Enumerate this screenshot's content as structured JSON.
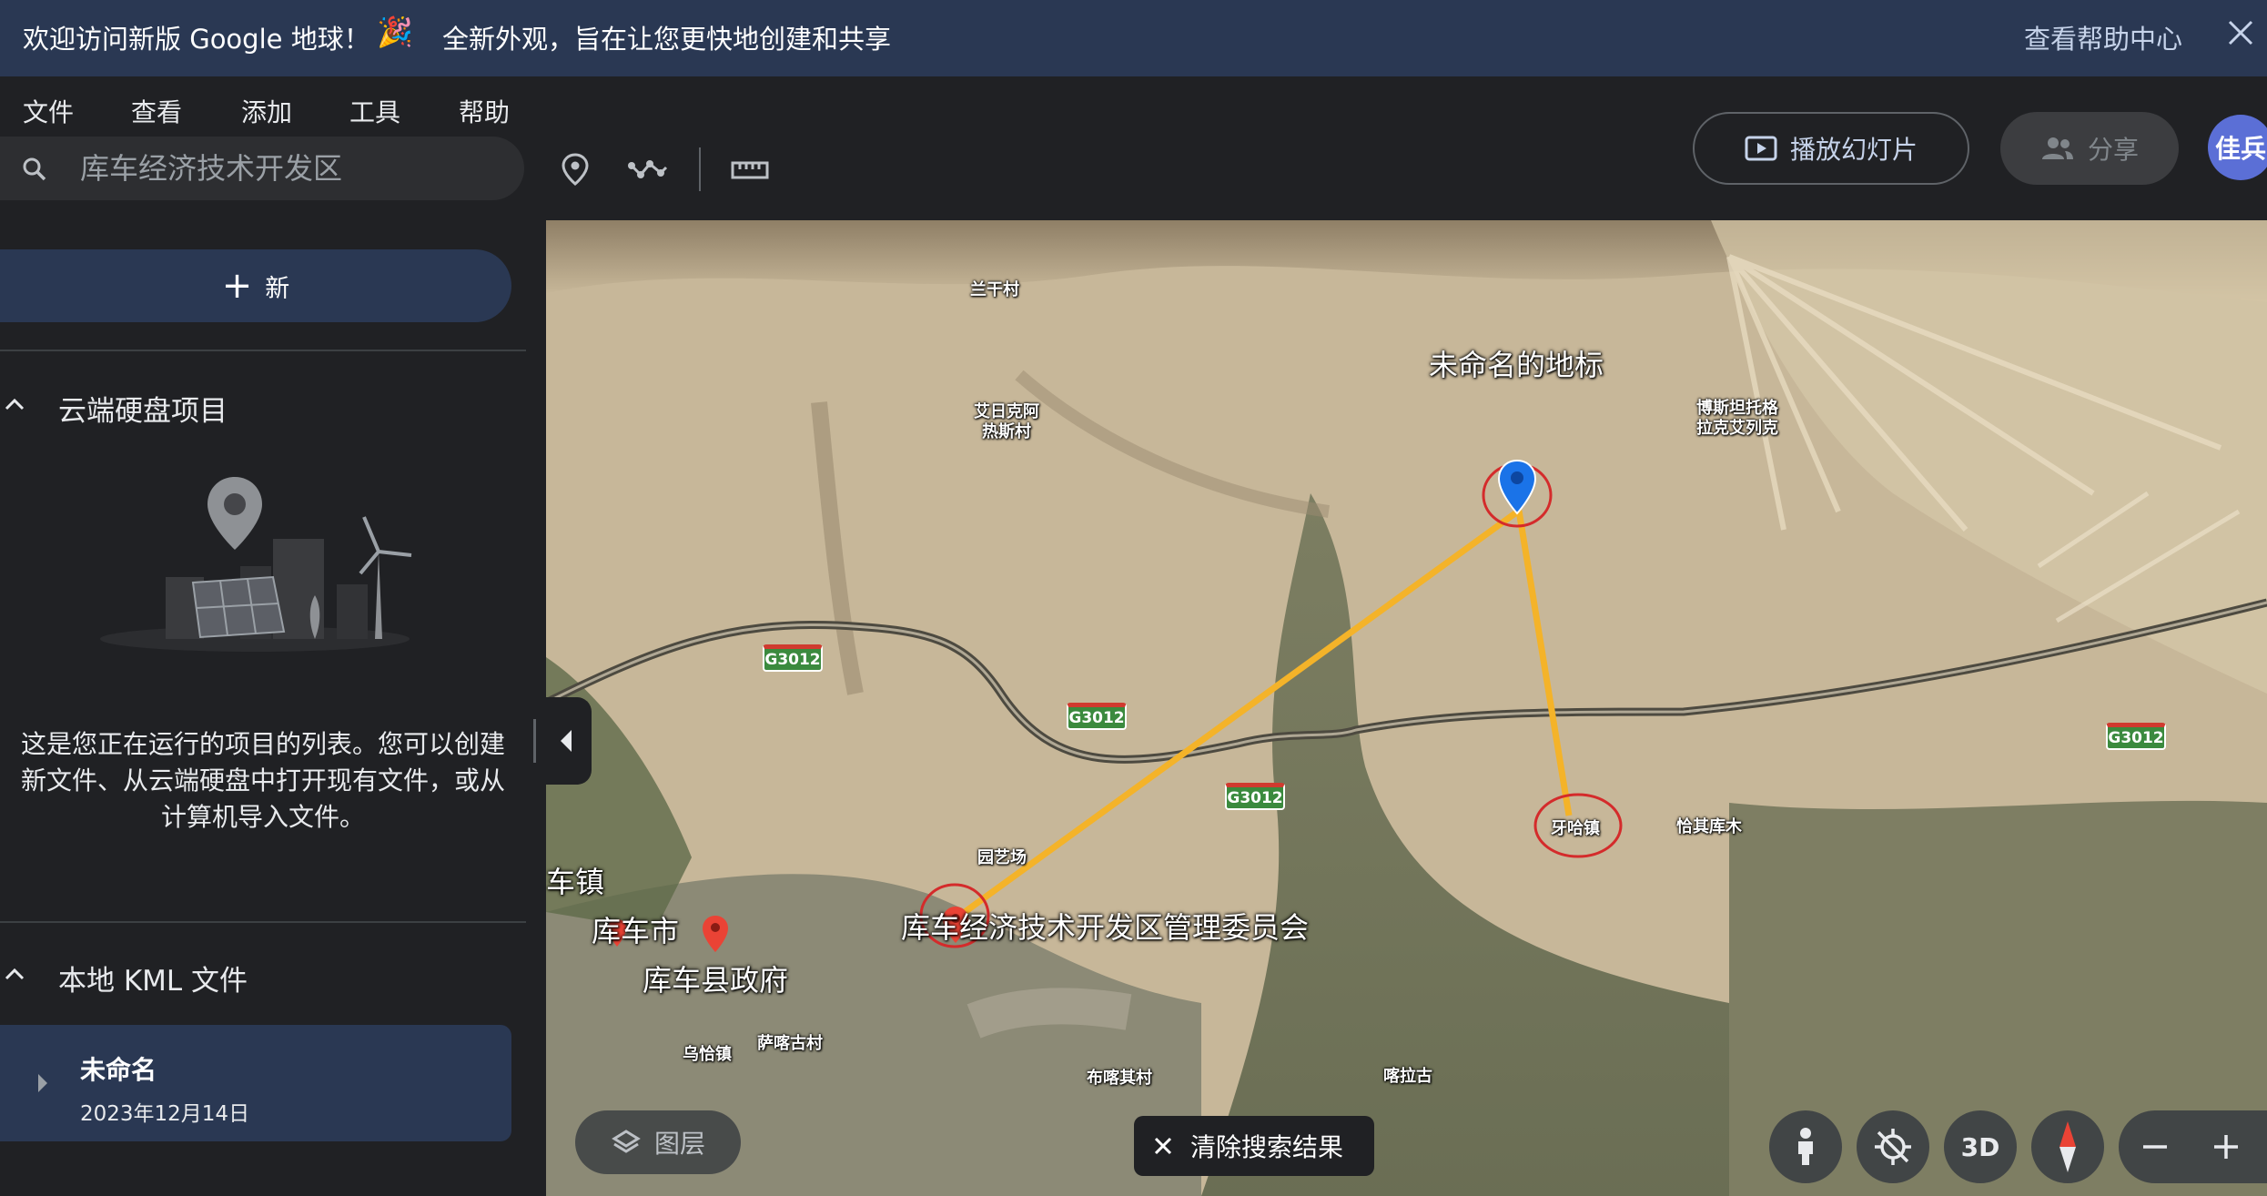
{
  "banner": {
    "welcome": "欢迎访问新版 Google 地球！",
    "party_icon": "🎉",
    "tagline": "全新外观，旨在让您更快地创建和共享",
    "help_link": "查看帮助中心"
  },
  "menu": [
    "文件",
    "查看",
    "添加",
    "工具",
    "帮助"
  ],
  "search": {
    "placeholder": "库车经济技术开发区"
  },
  "toolbar": {
    "slideshow_label": "播放幻灯片",
    "share_label": "分享",
    "avatar_text": "佳兵"
  },
  "sidebar": {
    "new_label": "新",
    "cloud_section_title": "云端硬盘项目",
    "empty_text_lines": [
      "这是您正在运行的项目的列表。您可以创建",
      "新文件、从云端硬盘中打开现有文件，或从",
      "计算机导入文件。"
    ],
    "local_section_title": "本地 KML 文件",
    "kml_item": {
      "name": "未命名",
      "date": "2023年12月14日"
    }
  },
  "map": {
    "big_labels": {
      "landmark": "未命名的地标",
      "dev_zone": "库车经济技术开发区管理委员会",
      "kuche_city": "库车市",
      "kuche_gov": "库车县政府",
      "town_partial": "车镇"
    },
    "small_labels": {
      "lanqian": "兰干村",
      "airi_1": "艾日克阿",
      "airi_2": "热斯村",
      "bosi_1": "博斯坦托格",
      "bosi_2": "拉克艾列克",
      "yuanyi": "园艺场",
      "yaha": "牙哈镇",
      "qiaqi": "恰其库木",
      "wuqia": "乌恰镇",
      "sakai": "萨喀古村",
      "bukai": "布喀其村",
      "kaigu": "喀拉古"
    },
    "highway_label": "G3012"
  },
  "controls": {
    "layers_label": "图层",
    "clear_label": "清除搜索结果",
    "three_d_label": "3D"
  },
  "colors": {
    "banner_bg": "#2a3853",
    "app_bg": "#202124",
    "route_line": "#f4b329",
    "marker_blue": "#1a73e8",
    "marker_red": "#ea4335"
  }
}
